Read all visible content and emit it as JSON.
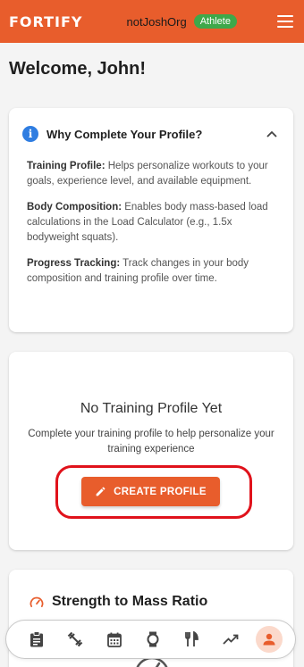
{
  "header": {
    "brand": "FORTIFY",
    "org": "notJoshOrg",
    "role_badge": "Athlete"
  },
  "welcome": "Welcome, John!",
  "why_card": {
    "title": "Why Complete Your Profile?",
    "items": [
      {
        "term": "Training Profile:",
        "text": " Helps personalize workouts to your goals, experience level, and available equipment."
      },
      {
        "term": "Body Composition:",
        "text": " Enables body mass-based load calculations in the Load Calculator (e.g., 1.5x bodyweight squats)."
      },
      {
        "term": "Progress Tracking:",
        "text": " Track changes in your body composition and training profile over time."
      }
    ]
  },
  "no_profile": {
    "title": "No Training Profile Yet",
    "description": "Complete your training profile to help personalize your training experience",
    "button": "CREATE PROFILE"
  },
  "strength": {
    "title": "Strength to Mass Ratio"
  },
  "bottom_nav": {
    "items": [
      "clipboard-icon",
      "exercise-icon",
      "calendar-icon",
      "watch-icon",
      "utensils-icon",
      "trending-icon",
      "person-icon"
    ],
    "active": "person-icon"
  },
  "colors": {
    "brand": "#e85d2c",
    "badge": "#3ea84a",
    "info": "#2f7de1",
    "highlight": "#e0121b"
  }
}
